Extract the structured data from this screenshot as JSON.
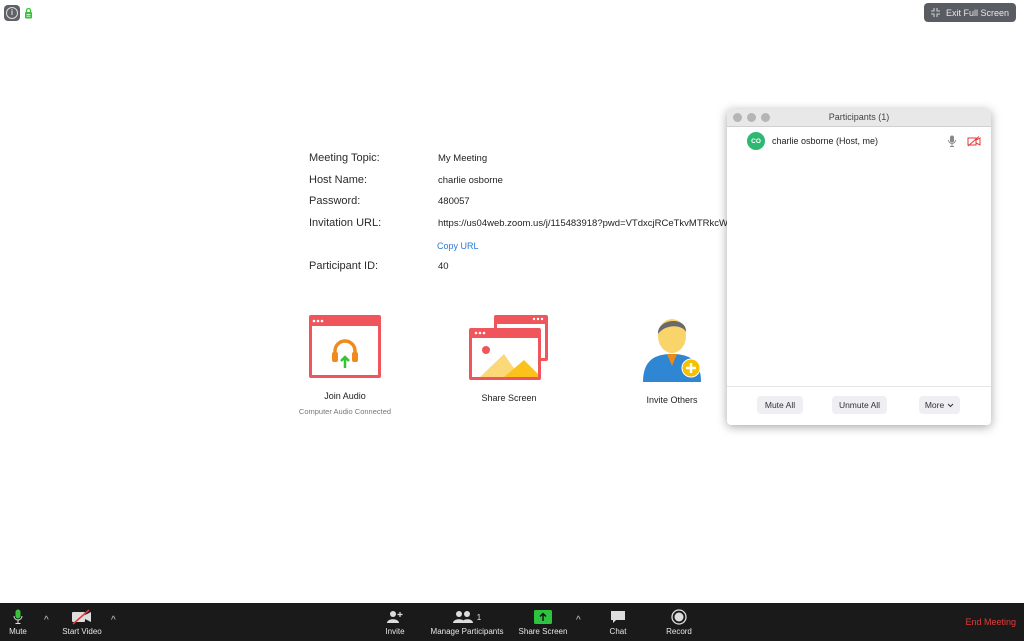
{
  "top": {
    "info_icon": "info-icon",
    "lock_icon": "lock-icon",
    "exit_fullscreen_label": "Exit Full Screen"
  },
  "meeting_info": {
    "rows": [
      {
        "label": "Meeting Topic:",
        "value": "My Meeting"
      },
      {
        "label": "Host Name:",
        "value": "charlie osborne"
      },
      {
        "label": "Password:",
        "value": "480057"
      },
      {
        "label": "Invitation URL:",
        "value": "https://us04web.zoom.us/j/115483918?pwd=VTdxcjRCeTkvMTRkcW"
      },
      {
        "label": "Participant ID:",
        "value": "40"
      }
    ],
    "copy_url_label": "Copy URL",
    "link_color": "#2b7bd6"
  },
  "actions": [
    {
      "label": "Join Audio",
      "sub": "Computer Audio Connected",
      "icon": "headphones-icon"
    },
    {
      "label": "Share Screen",
      "sub": "",
      "icon": "share-screen-icon"
    },
    {
      "label": "Invite Others",
      "sub": "",
      "icon": "invite-person-icon"
    }
  ],
  "participants_panel": {
    "title": "Participants (1)",
    "participants": [
      {
        "initials": "CO",
        "name": "charlie osborne (Host, me)",
        "avatar_color": "#2eb872",
        "mic": "mic-icon",
        "video": "video-off-icon"
      }
    ],
    "buttons": {
      "mute_all": "Mute All",
      "unmute_all": "Unmute All",
      "more": "More"
    }
  },
  "toolbar": {
    "mute": "Mute",
    "start_video": "Start Video",
    "invite": "Invite",
    "manage_participants": "Manage Participants",
    "participant_count": "1",
    "share_screen": "Share Screen",
    "chat": "Chat",
    "record": "Record",
    "end_meeting": "End Meeting",
    "end_color": "#e5393a",
    "share_color": "#2ec33f"
  }
}
